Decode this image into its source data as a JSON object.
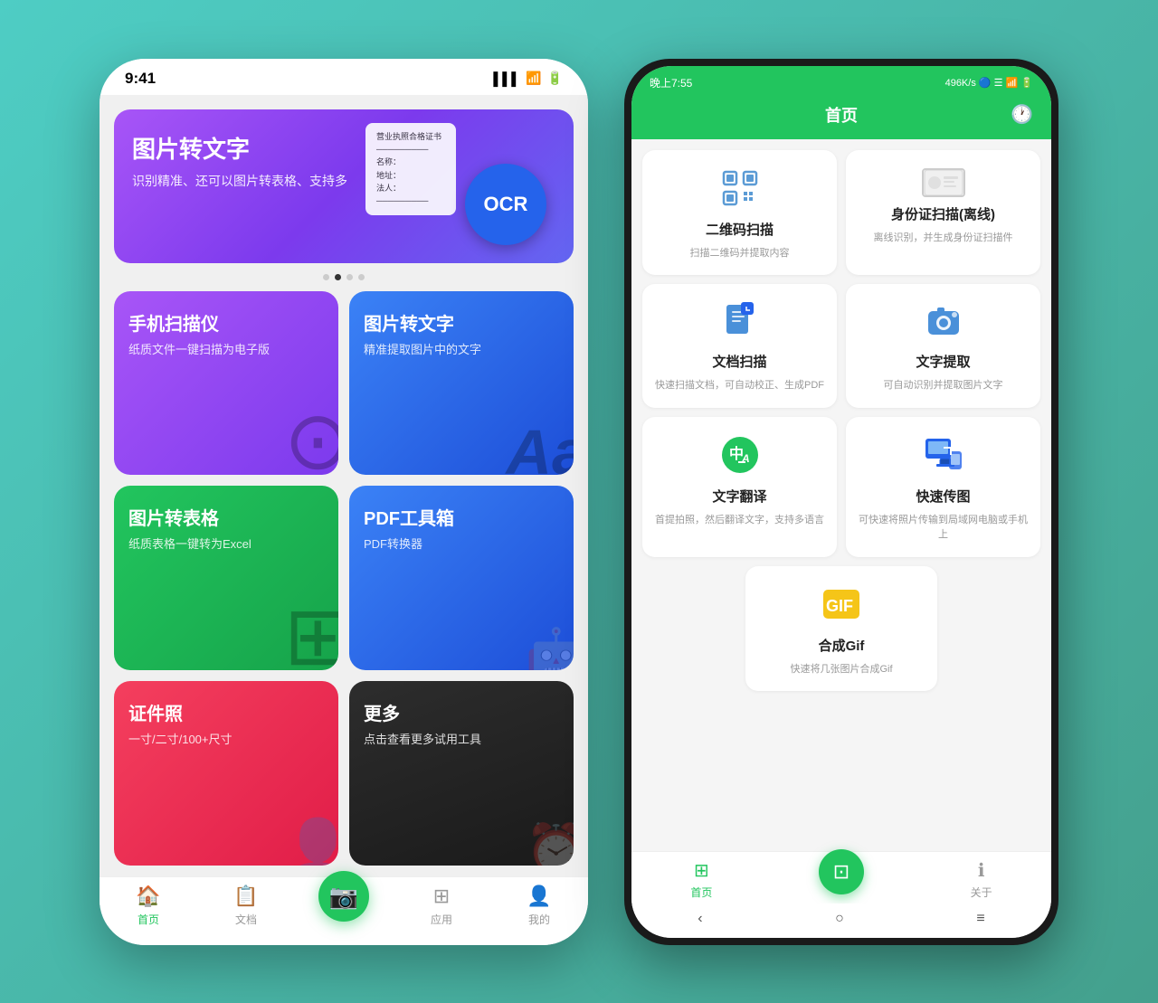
{
  "left_phone": {
    "status_bar": {
      "time": "9:41",
      "signal": "📶",
      "wifi": "📶",
      "battery": "🔋"
    },
    "banner": {
      "title": "图片转文字",
      "subtitle": "识别精准、还可以图片转表格、支持多",
      "ocr_label": "OCR"
    },
    "dots": [
      "",
      "",
      "",
      ""
    ],
    "cards": [
      {
        "id": "phone-scanner",
        "title": "手机扫描仪",
        "subtitle": "纸质文件一键扫描为电子版",
        "color": "purple"
      },
      {
        "id": "image-to-text",
        "title": "图片转文字",
        "subtitle": "精准提取图片中的文字",
        "color": "blue"
      },
      {
        "id": "image-to-table",
        "title": "图片转表格",
        "subtitle": "纸质表格一键转为Excel",
        "color": "green"
      },
      {
        "id": "pdf-toolbox",
        "title": "PDF工具箱",
        "subtitle": "PDF转换器",
        "color": "blue"
      },
      {
        "id": "id-photo",
        "title": "证件照",
        "subtitle": "一寸/二寸/100+尺寸",
        "color": "pink"
      },
      {
        "id": "more",
        "title": "更多",
        "subtitle": "点击查看更多试用工具",
        "color": "dark"
      }
    ],
    "bottom_nav": [
      {
        "icon": "🏠",
        "label": "首页",
        "active": true
      },
      {
        "icon": "📋",
        "label": "文档",
        "active": false
      },
      {
        "icon": "📷",
        "label": "",
        "active": false,
        "camera": true
      },
      {
        "icon": "⊞",
        "label": "应用",
        "active": false
      },
      {
        "icon": "👤",
        "label": "我的",
        "active": false
      }
    ]
  },
  "right_phone": {
    "status_bar": {
      "time": "晚上7:55",
      "info": "496K/s 🔵 ☰ 📶 🔋"
    },
    "header": {
      "title": "首页",
      "clock_icon": "🕐"
    },
    "features": [
      {
        "id": "qr-scan",
        "title": "二维码扫描",
        "subtitle": "扫描二维码并提取内容",
        "icon_type": "qr"
      },
      {
        "id": "id-scan",
        "title": "身份证扫描(离线)",
        "subtitle": "离线识别，并生成身份证扫描件",
        "icon_type": "id"
      },
      {
        "id": "doc-scan",
        "title": "文档扫描",
        "subtitle": "快速扫描文档，可自动校正、生成PDF",
        "icon_type": "doc"
      },
      {
        "id": "text-extract",
        "title": "文字提取",
        "subtitle": "可自动识别并提取图片文字",
        "icon_type": "camera"
      },
      {
        "id": "text-translate",
        "title": "文字翻译",
        "subtitle": "首提拍照，然后翻译文字，支持多语言",
        "icon_type": "translate"
      },
      {
        "id": "fast-transfer",
        "title": "快速传图",
        "subtitle": "可快速将照片传输到局域网电脑或手机上",
        "icon_type": "transfer"
      },
      {
        "id": "gif-maker",
        "title": "合成Gif",
        "subtitle": "快速将几张图片合成Gif",
        "icon_type": "gif"
      }
    ],
    "bottom_nav": [
      {
        "icon": "⊞",
        "label": "首页",
        "active": true
      },
      {
        "icon": "📷",
        "label": "",
        "active": false,
        "camera": true
      },
      {
        "icon": "ℹ",
        "label": "关于",
        "active": false
      }
    ],
    "android_nav": [
      "‹",
      "○",
      "≡"
    ]
  }
}
